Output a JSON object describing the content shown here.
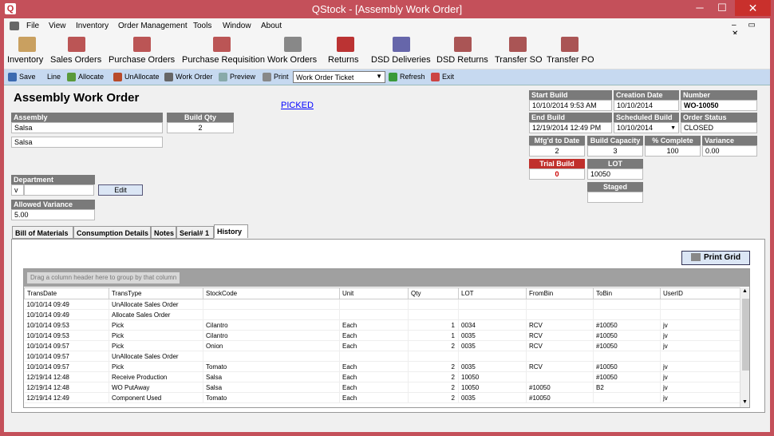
{
  "window": {
    "title": "QStock - [Assembly Work Order]",
    "app_icon": "Q",
    "min": "─",
    "max": "☐",
    "close": "✕"
  },
  "menu": [
    "File",
    "View",
    "Inventory",
    "Order Management",
    "Tools",
    "Window",
    "About"
  ],
  "mdi_controls": "– ▭ ✕",
  "toolbar": [
    {
      "label": "Inventory",
      "icon": "inventory-icon",
      "color": "#c9a060"
    },
    {
      "label": "Sales Orders",
      "icon": "sales-orders-icon",
      "color": "#b55"
    },
    {
      "label": "Purchase Orders",
      "icon": "purchase-orders-icon",
      "color": "#b55"
    },
    {
      "label": "Purchase Requisition",
      "icon": "purchase-requisition-icon",
      "color": "#b55"
    },
    {
      "label": "Work Orders",
      "icon": "work-orders-icon",
      "color": "#888"
    },
    {
      "label": "Returns",
      "icon": "returns-icon",
      "color": "#b33"
    },
    {
      "label": "DSD Deliveries",
      "icon": "dsd-deliveries-icon",
      "color": "#66a"
    },
    {
      "label": "DSD Returns",
      "icon": "dsd-returns-icon",
      "color": "#a55"
    },
    {
      "label": "Transfer SO",
      "icon": "transfer-so-icon",
      "color": "#a55"
    },
    {
      "label": "Transfer PO",
      "icon": "transfer-po-icon",
      "color": "#a55"
    }
  ],
  "actions": {
    "save": "Save",
    "line": "Line",
    "allocate": "Allocate",
    "unallocate": "UnAllocate",
    "work_order": "Work Order",
    "preview": "Preview",
    "print": "Print",
    "ticket": "Work Order Ticket",
    "refresh": "Refresh",
    "exit": "Exit"
  },
  "form": {
    "title": "Assembly Work Order",
    "status_link": "PICKED",
    "assembly_label": "Assembly",
    "assembly_value": "Salsa",
    "assembly_desc": "Salsa",
    "build_qty_label": "Build Qty",
    "build_qty_value": "2",
    "department_label": "Department",
    "department_value": "",
    "edit": "Edit",
    "allowed_variance_label": "Allowed Variance",
    "allowed_variance_value": "5.00",
    "start_build_label": "Start Build",
    "start_build_value": "10/10/2014 9:53 AM",
    "creation_date_label": "Creation Date",
    "creation_date_value": "10/10/2014",
    "number_label": "Number",
    "number_value": "WO-10050",
    "end_build_label": "End Build",
    "end_build_value": "12/19/2014 12:49 PM",
    "scheduled_build_label": "Scheduled Build",
    "scheduled_build_value": "10/10/2014",
    "order_status_label": "Order Status",
    "order_status_value": "CLOSED",
    "mfgd_label": "Mfg'd to Date",
    "mfgd_value": "2",
    "capacity_label": "Build Capacity",
    "capacity_value": "3",
    "complete_label": "% Complete",
    "complete_value": "100",
    "variance_label": "Variance",
    "variance_value": "0.00",
    "trial_label": "Trial Build",
    "trial_value": "0",
    "lot_label": "LOT",
    "lot_value": "10050",
    "staged_label": "Staged",
    "staged_value": ""
  },
  "tabs": [
    "Bill of Materials",
    "Consumption Details",
    "Notes",
    "Serial# 1",
    "History"
  ],
  "print_grid": "Print Grid",
  "grid": {
    "group_hint": "Drag a column header here to group by that column",
    "columns": [
      "TransDate",
      "TransType",
      "StockCode",
      "Unit",
      "Qty",
      "LOT",
      "FromBin",
      "ToBin",
      "UserID"
    ],
    "rows": [
      [
        "10/10/14 09:49",
        "UnAllocate Sales Order",
        "",
        "",
        "",
        "",
        "",
        "",
        ""
      ],
      [
        "10/10/14 09:49",
        "Allocate Sales Order",
        "",
        "",
        "",
        "",
        "",
        "",
        ""
      ],
      [
        "10/10/14 09:53",
        "Pick",
        "Cilantro",
        "Each",
        "1",
        "0034",
        "RCV",
        "#10050",
        "jv"
      ],
      [
        "10/10/14 09:53",
        "Pick",
        "Cilantro",
        "Each",
        "1",
        "0035",
        "RCV",
        "#10050",
        "jv"
      ],
      [
        "10/10/14 09:57",
        "Pick",
        "Onion",
        "Each",
        "2",
        "0035",
        "RCV",
        "#10050",
        "jv"
      ],
      [
        "10/10/14 09:57",
        "UnAllocate Sales Order",
        "",
        "",
        "",
        "",
        "",
        "",
        ""
      ],
      [
        "10/10/14 09:57",
        "Pick",
        "Tomato",
        "Each",
        "2",
        "0035",
        "RCV",
        "#10050",
        "jv"
      ],
      [
        "12/19/14 12:48",
        "Receive Production",
        "Salsa",
        "Each",
        "2",
        "10050",
        "",
        "#10050",
        "jv"
      ],
      [
        "12/19/14 12:48",
        "WO PutAway",
        "Salsa",
        "Each",
        "2",
        "10050",
        "#10050",
        "B2",
        "jv"
      ],
      [
        "12/19/14 12:49",
        "Component Used",
        "Tomato",
        "Each",
        "2",
        "0035",
        "#10050",
        "",
        "jv"
      ]
    ]
  }
}
